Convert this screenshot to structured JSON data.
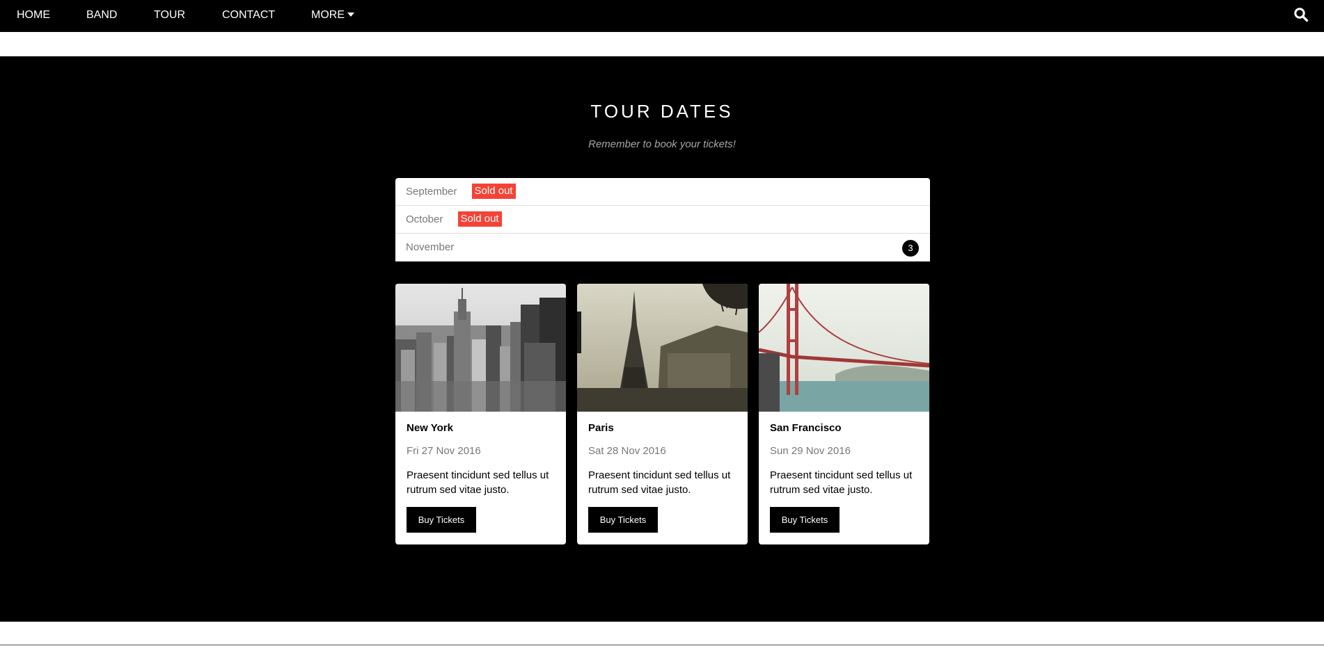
{
  "nav": {
    "items": [
      {
        "label": "HOME"
      },
      {
        "label": "BAND"
      },
      {
        "label": "TOUR"
      },
      {
        "label": "CONTACT"
      },
      {
        "label": "MORE"
      }
    ],
    "icons": {
      "more": "caret-down-icon",
      "search": "search-icon"
    }
  },
  "tour": {
    "title": "TOUR DATES",
    "subtitle": "Remember to book your tickets!",
    "months": [
      {
        "name": "September",
        "badge": "Sold out"
      },
      {
        "name": "October",
        "badge": "Sold out"
      },
      {
        "name": "November",
        "count": "3"
      }
    ],
    "cards": [
      {
        "city": "New York",
        "date": "Fri 27 Nov 2016",
        "text": "Praesent tincidunt sed tellus ut rutrum sed vitae justo.",
        "button": "Buy Tickets",
        "image": "new-york-skyline-photo"
      },
      {
        "city": "Paris",
        "date": "Sat 28 Nov 2016",
        "text": "Praesent tincidunt sed tellus ut rutrum sed vitae justo.",
        "button": "Buy Tickets",
        "image": "paris-eiffel-tower-photo"
      },
      {
        "city": "San Francisco",
        "date": "Sun 29 Nov 2016",
        "text": "Praesent tincidunt sed tellus ut rutrum sed vitae justo.",
        "button": "Buy Tickets",
        "image": "golden-gate-bridge-photo"
      }
    ]
  },
  "colors": {
    "navbar": "#000000",
    "section": "#000000",
    "sold_out": "#f44336",
    "muted_text": "#777777",
    "subtitle": "#a6a6a6"
  }
}
